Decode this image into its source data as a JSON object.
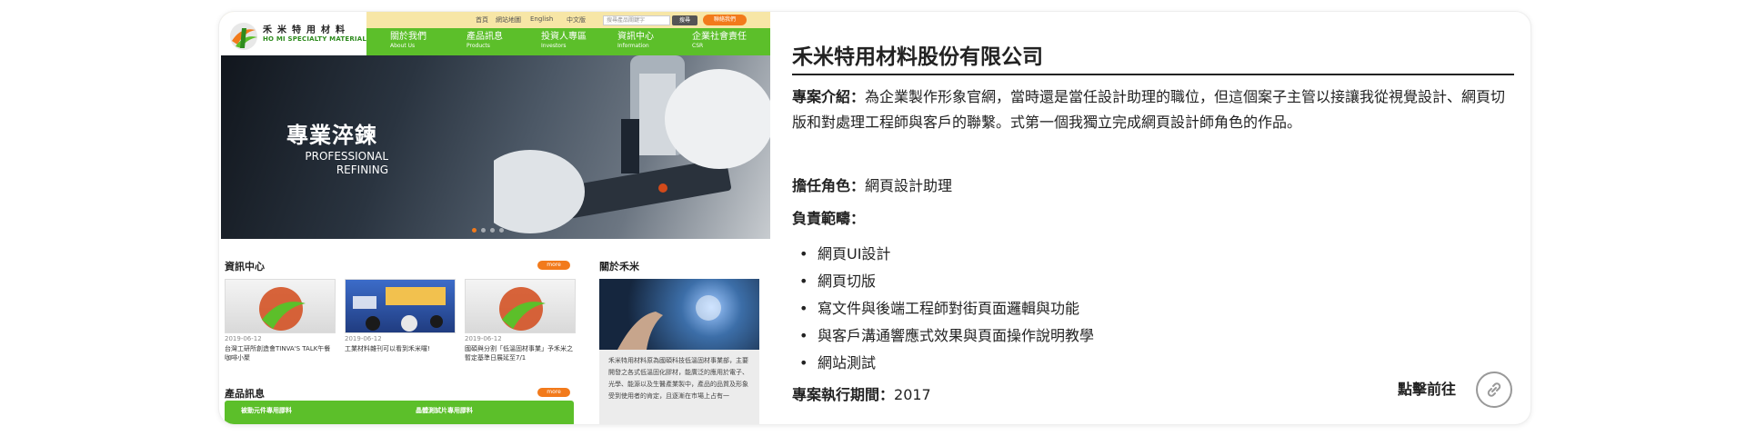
{
  "screenshot": {
    "logo": {
      "zh": "禾米特用材料",
      "en": "HO MI SPECIALTY MATERIALS"
    },
    "utility_links": [
      "首頁",
      "網站地圖",
      "English",
      "中文版"
    ],
    "search": {
      "placeholder": "搜尋產品關鍵字",
      "button": "搜尋"
    },
    "contact_label": "聯絡我們",
    "nav": [
      {
        "zh": "關於我們",
        "en": "About Us"
      },
      {
        "zh": "產品訊息",
        "en": "Products"
      },
      {
        "zh": "投資人專區",
        "en": "Investors"
      },
      {
        "zh": "資訊中心",
        "en": "Information"
      },
      {
        "zh": "企業社會責任",
        "en": "CSR"
      }
    ],
    "hero": {
      "title": "專業淬鍊",
      "subtitle_line1": "PROFESSIONAL",
      "subtitle_line2": "REFINING"
    },
    "news_section": {
      "title": "資訊中心",
      "more": "more",
      "items": [
        {
          "date": "2019-06-12",
          "text": "台灣工研所創造會TINVA'S TALK午餐咖啡小聚"
        },
        {
          "date": "2019-06-12",
          "text": "工業材料雜刊可以看到禾米囉!"
        },
        {
          "date": "2019-06-12",
          "text": "國碩與分割「低溫固材事業」予禾米之暫定基準日展延至7/1"
        }
      ]
    },
    "about_section": {
      "title": "關於禾米",
      "text": "禾米特用材料原為國碩科技低溫固材事業部，主要開發之各式低溫固化膠材，能廣泛的應用於電子、光學、能源以及生醫產業製中，產品的品質及形象受到使用者的肯定，且逐漸在市場上占有一"
    },
    "product_section": {
      "title": "產品訊息",
      "more": "more",
      "items": [
        "被動元件專用膠料",
        "晶體測試片專用膠料"
      ]
    }
  },
  "project": {
    "company_name": "禾米特用材料股份有限公司",
    "intro_label": "專案介紹：",
    "intro_text": "為企業製作形象官網，當時還是當任設計助理的職位，但這個案子主管以接讓我從視覺設計、網頁切版和對處理工程師與客戶的聯繫。式第一個我獨立完成網頁設計師角色的作品。",
    "role_label": "擔任角色：",
    "role_value": "網頁設計助理",
    "scope_label": "負責範疇：",
    "responsibilities": [
      "網頁UI設計",
      "網頁切版",
      "寫文件與後端工程師對街頁面邏輯與功能",
      "與客戶溝通響應式效果與頁面操作說明教學",
      "網站測試"
    ],
    "period_label": "專案執行期間：",
    "period_value": "2017",
    "visit_label": "點擊前往"
  },
  "colors": {
    "brand_green": "#5cbf2a",
    "accent_orange": "#f27a1b",
    "topbar_yellow": "#f7e6a6"
  },
  "icons": [
    "link-icon",
    "search-icon"
  ]
}
